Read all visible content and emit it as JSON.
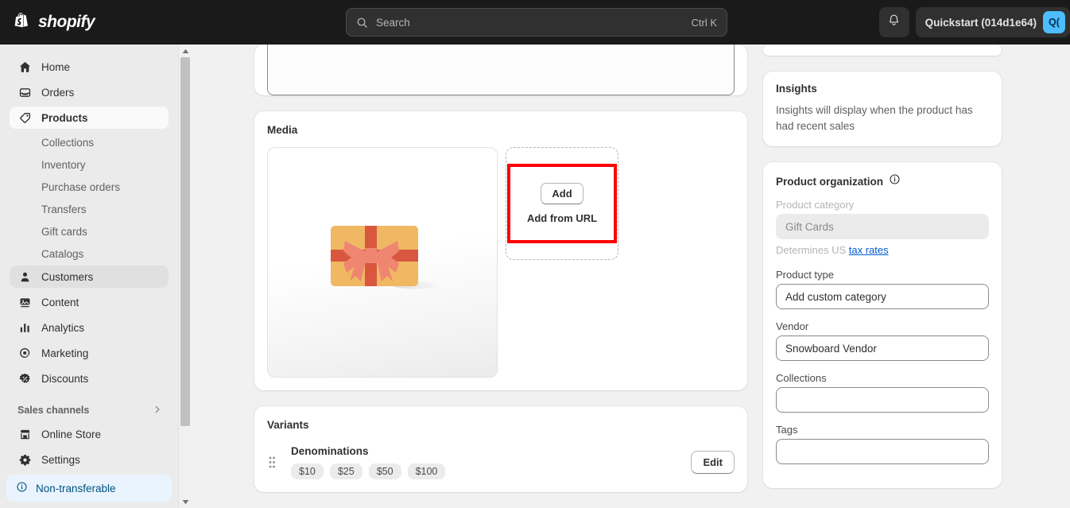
{
  "topbar": {
    "brand": "shopify",
    "search": {
      "placeholder": "Search",
      "shortcut": "Ctrl K",
      "icon": "search-icon"
    },
    "notifications_icon": "bell-icon",
    "store_name": "Quickstart (014d1e64)",
    "avatar_initials": "Q("
  },
  "sidebar": {
    "items": [
      {
        "label": "Home",
        "icon": "home-icon",
        "state": "default"
      },
      {
        "label": "Orders",
        "icon": "orders-inbox-icon",
        "state": "default"
      },
      {
        "label": "Products",
        "icon": "products-tag-icon",
        "state": "active"
      }
    ],
    "product_subitems": [
      {
        "label": "Collections"
      },
      {
        "label": "Inventory"
      },
      {
        "label": "Purchase orders"
      },
      {
        "label": "Transfers"
      },
      {
        "label": "Gift cards"
      },
      {
        "label": "Catalogs"
      }
    ],
    "items_lower": [
      {
        "label": "Customers",
        "icon": "customers-person-icon",
        "state": "hovered"
      },
      {
        "label": "Content",
        "icon": "content-image-icon",
        "state": "default"
      },
      {
        "label": "Analytics",
        "icon": "analytics-bars-icon",
        "state": "default"
      },
      {
        "label": "Marketing",
        "icon": "marketing-target-icon",
        "state": "default"
      },
      {
        "label": "Discounts",
        "icon": "discounts-badge-icon",
        "state": "default"
      }
    ],
    "section_label": "Sales channels",
    "section_chevron_icon": "chevron-right-icon",
    "channels": [
      {
        "label": "Online Store",
        "icon": "online-store-icon"
      }
    ],
    "settings": {
      "label": "Settings",
      "icon": "gear-icon"
    },
    "footer_banner": {
      "label": "Non-transferable",
      "icon": "info-circle-icon"
    }
  },
  "main": {
    "media": {
      "title": "Media",
      "thumbnail_alt": "gift-card-image",
      "add_button": "Add",
      "add_from_url": "Add from URL",
      "highlight_color": "#ff0000"
    },
    "variants": {
      "title": "Variants",
      "drag_handle_icon": "drag-handle-icon",
      "option_name": "Denominations",
      "option_values": [
        "$10",
        "$25",
        "$50",
        "$100"
      ],
      "edit_button": "Edit"
    }
  },
  "right_panel": {
    "insights": {
      "title": "Insights",
      "body": "Insights will display when the product has had recent sales"
    },
    "product_organization": {
      "title": "Product organization",
      "info_icon": "info-circle-icon",
      "fields": [
        {
          "label": "Product category",
          "value": "Gift Cards",
          "disabled": true,
          "helper_prefix": "Determines US ",
          "helper_link": "tax rates"
        },
        {
          "label": "Product type",
          "value": "Add custom category",
          "disabled": false
        },
        {
          "label": "Vendor",
          "value": "Snowboard Vendor",
          "disabled": false
        },
        {
          "label": "Collections",
          "value": "",
          "disabled": false
        },
        {
          "label": "Tags",
          "value": "",
          "disabled": false
        }
      ]
    }
  },
  "scrollbar": {
    "up_arrow_icon": "triangle-up-icon",
    "down_arrow_icon": "triangle-down-icon"
  },
  "colors": {
    "accent_link": "#005bd3",
    "topbar_bg": "#1a1a1a",
    "avatar_bg": "#4dbdff",
    "highlight": "#ff0000"
  }
}
